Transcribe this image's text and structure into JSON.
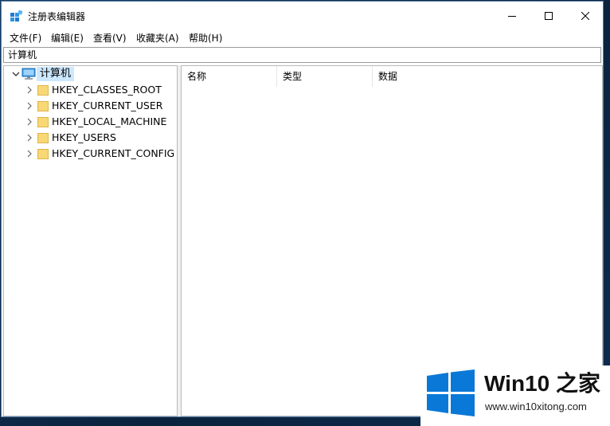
{
  "window": {
    "title": "注册表编辑器"
  },
  "menu": {
    "items": [
      "文件(F)",
      "编辑(E)",
      "查看(V)",
      "收藏夹(A)",
      "帮助(H)"
    ]
  },
  "address": {
    "path": "计算机"
  },
  "tree": {
    "root": "计算机",
    "children": [
      "HKEY_CLASSES_ROOT",
      "HKEY_CURRENT_USER",
      "HKEY_LOCAL_MACHINE",
      "HKEY_USERS",
      "HKEY_CURRENT_CONFIG"
    ]
  },
  "list": {
    "columns": [
      "名称",
      "类型",
      "数据"
    ]
  },
  "watermark": {
    "title": "Win10 之家",
    "url": "www.win10xitong.com"
  },
  "colors": {
    "selection": "#cce8ff",
    "folder": "#f8d775",
    "brand": "#0a78d7"
  }
}
